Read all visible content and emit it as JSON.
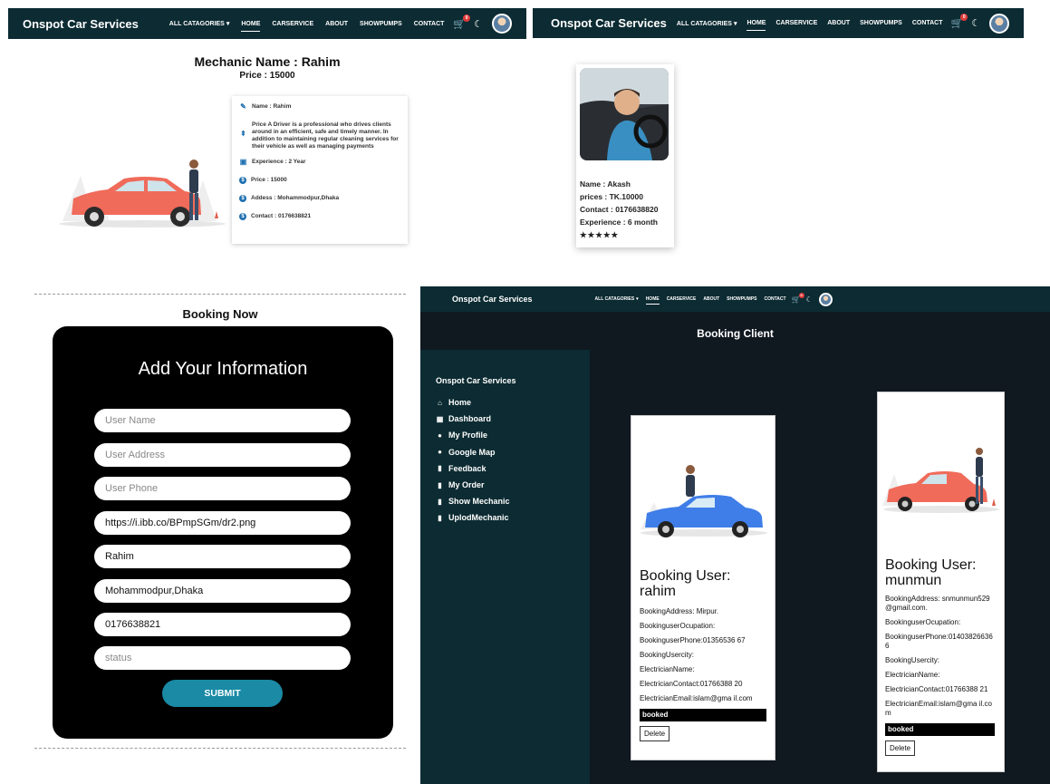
{
  "nav": {
    "brand": "Onspot Car Services",
    "links": [
      "ALL CATAGORIES",
      "HOME",
      "CARSERVICE",
      "ABOUT",
      "SHOWPUMPS",
      "CONTACT"
    ],
    "cart_count": "0"
  },
  "mechanic_detail": {
    "title": "Mechanic Name : Rahim",
    "price": "Price : 15000",
    "name": "Name : Rahim",
    "description": "Price A Driver is a professional who drives clients around in an efficient, safe and timely manner. In addition to maintaining regular cleaning services for their vehicle as well as managing payments",
    "experience": "Experience : 2 Year",
    "price_line": "Price : 15000",
    "address": "Addess : Mohammodpur,Dhaka",
    "contact": "Contact : 0176638821"
  },
  "mechanic_card": {
    "name": "Name : Akash",
    "price": "prices : TK.10000",
    "contact": "Contact : 0176638820",
    "experience": "Experience : 6 month",
    "rating": 5
  },
  "booking_form": {
    "heading": "Booking Now",
    "title": "Add Your Information",
    "fields": [
      {
        "placeholder": "User Name",
        "value": ""
      },
      {
        "placeholder": "User Address",
        "value": ""
      },
      {
        "placeholder": "User Phone",
        "value": ""
      },
      {
        "placeholder": "",
        "value": "https://i.ibb.co/BPmpSGm/dr2.png"
      },
      {
        "placeholder": "",
        "value": "Rahim"
      },
      {
        "placeholder": "",
        "value": "Mohammodpur,Dhaka"
      },
      {
        "placeholder": "",
        "value": "0176638821"
      },
      {
        "placeholder": "status",
        "value": ""
      }
    ],
    "submit": "SUBMIT"
  },
  "dashboard": {
    "page_title": "Booking Client",
    "sidebar_title": "Onspot Car Services",
    "sidebar_items": [
      "Home",
      "Dashboard",
      "My Profile",
      "Google Map",
      "Feedback",
      "My Order",
      "Show Mechanic",
      "UplodMechanic"
    ],
    "bookings": [
      {
        "user": "Booking User: rahim",
        "address": "BookingAddress: Mirpur.",
        "occupation": "BookinguserOcupation:",
        "phone": "BookinguserPhone:01356536 67",
        "city": "BookingUsercity:",
        "electrician_name": "ElectricianName:",
        "electrician_contact": "ElectricianContact:01766388 20",
        "electrician_email": "ElectricianEmail:islam@gma il.com",
        "status": "booked",
        "delete": "Delete"
      },
      {
        "user": "Booking User: munmun",
        "address": "BookingAddress: snmunmun529@gmail.com.",
        "occupation": "BookinguserOcupation:",
        "phone": "BookinguserPhone:01403826636 6",
        "city": "BookingUsercity:",
        "electrician_name": "ElectricianName:",
        "electrician_contact": "ElectricianContact:01766388 21",
        "electrician_email": "ElectricianEmail:islam@gma il.com",
        "status": "booked",
        "delete": "Delete"
      }
    ]
  },
  "colors": {
    "navbar": "#0c2b32",
    "dashboard_bg": "#101820",
    "accent": "#1a8aa5",
    "star": "#c2185b"
  }
}
